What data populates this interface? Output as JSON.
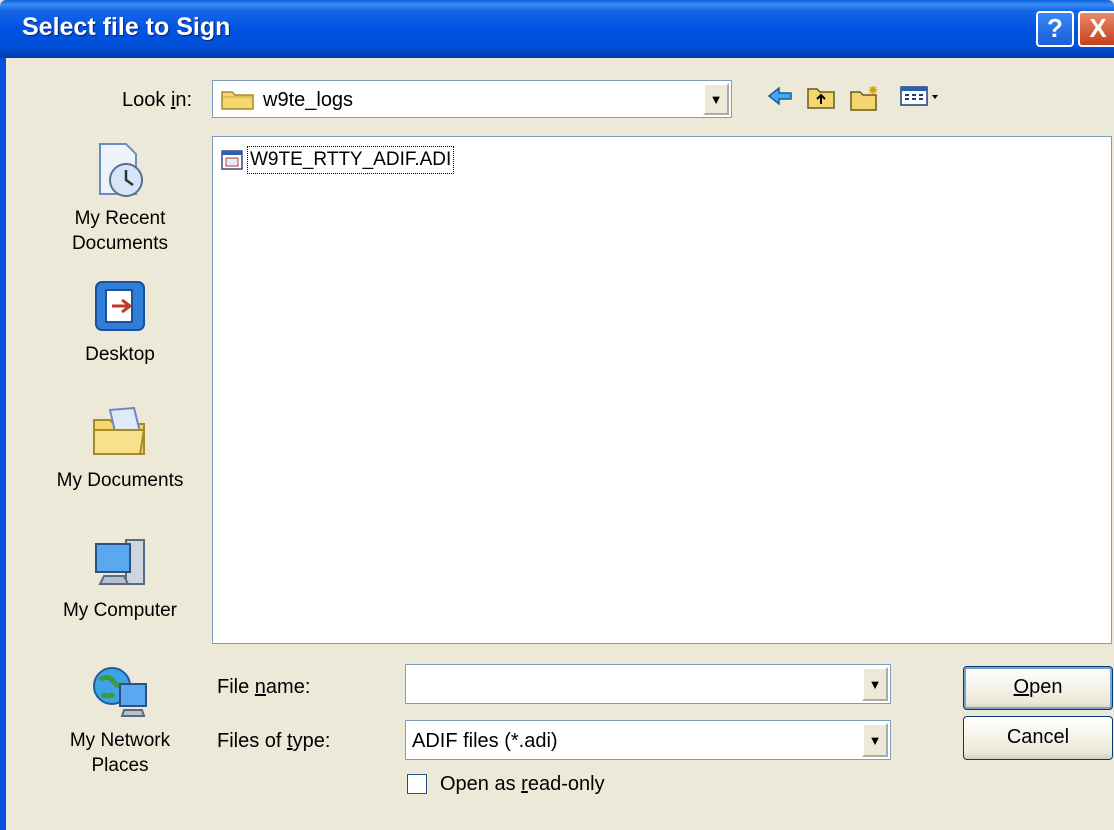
{
  "window": {
    "title": "Select file to Sign",
    "help_glyph": "?",
    "close_glyph": "X"
  },
  "lookin": {
    "label_pre": "Look ",
    "label_ul": "i",
    "label_post": "n:",
    "value": "w9te_logs"
  },
  "toolbar": {
    "icons": [
      "back-icon",
      "up-folder-icon",
      "new-folder-icon",
      "view-menu-icon"
    ]
  },
  "places": [
    {
      "name": "recent",
      "label_1": "My Recent",
      "label_2": "Documents"
    },
    {
      "name": "desktop",
      "label_1": "Desktop",
      "label_2": ""
    },
    {
      "name": "documents",
      "label_1": "My Documents",
      "label_2": ""
    },
    {
      "name": "computer",
      "label_1": "My Computer",
      "label_2": ""
    },
    {
      "name": "network",
      "label_1": "My Network",
      "label_2": "Places"
    }
  ],
  "files": [
    {
      "name": "W9TE_RTTY_ADIF.ADI"
    }
  ],
  "filename": {
    "label_pre": "File ",
    "label_ul": "n",
    "label_post": "ame:",
    "value": ""
  },
  "filetype": {
    "label_pre": "Files of ",
    "label_ul": "t",
    "label_post": "ype:",
    "value": "ADIF files (*.adi)"
  },
  "buttons": {
    "open_ul": "O",
    "open_rest": "pen",
    "cancel": "Cancel"
  },
  "readonly": {
    "label_pre": "Open as ",
    "label_ul": "r",
    "label_post": "ead-only",
    "checked": false
  }
}
